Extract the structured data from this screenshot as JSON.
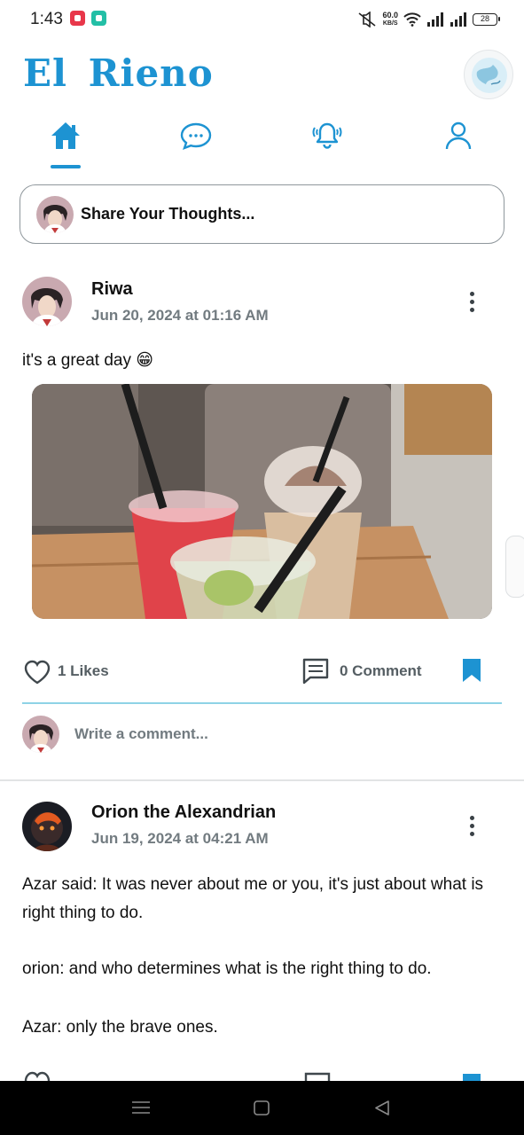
{
  "status_bar": {
    "time": "1:43",
    "net_speed_value": "60.0",
    "net_speed_unit": "KB/S",
    "battery": "28"
  },
  "header": {
    "app_title": "El Rieno"
  },
  "nav": {
    "tabs": [
      {
        "icon": "home-icon",
        "active": true
      },
      {
        "icon": "chat-icon",
        "active": false
      },
      {
        "icon": "bell-icon",
        "active": false
      },
      {
        "icon": "user-icon",
        "active": false
      }
    ],
    "accent_color": "#1d93d2"
  },
  "composer": {
    "placeholder": "Share Your Thoughts..."
  },
  "posts": [
    {
      "author": "Riwa",
      "date": "Jun 20, 2024 at 01:16 AM",
      "text": "it's a great day 😁",
      "has_image": true,
      "likes_label": "1 Likes",
      "comments_label": "0 Comment",
      "comment_placeholder": "Write a comment..."
    },
    {
      "author": "Orion the Alexandrian",
      "date": "Jun 19, 2024 at 04:21 AM",
      "lines": [
        "Azar said: It was never about me or you, it's just about what is right thing to do.",
        "orion: and who determines what is the right thing to do.",
        "Azar: only the brave ones."
      ]
    }
  ]
}
